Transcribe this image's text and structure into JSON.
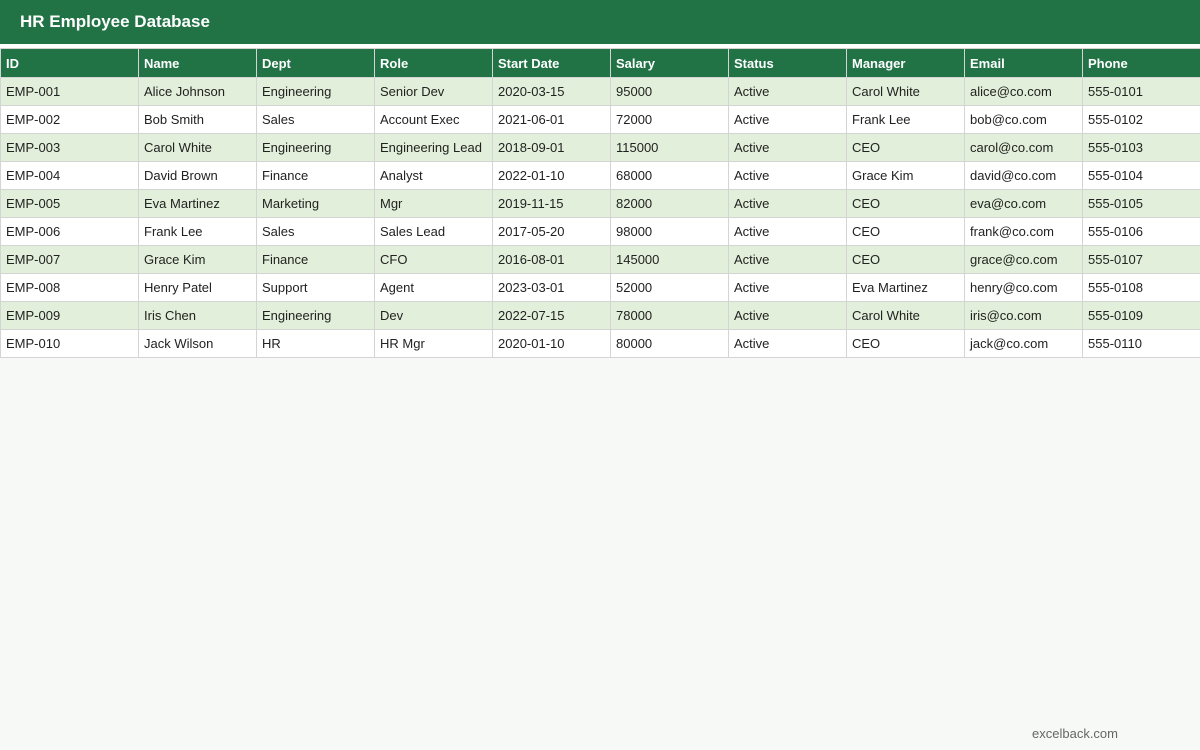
{
  "app": {
    "title": "HR Employee Database",
    "accent_color": "#217346",
    "band_color": "#e2efda"
  },
  "table": {
    "columns": [
      "ID",
      "Name",
      "Dept",
      "Role",
      "Start Date",
      "Salary",
      "Status",
      "Manager",
      "Email",
      "Phone"
    ],
    "rows": [
      [
        "EMP-001",
        "Alice Johnson",
        "Engineering",
        "Senior Dev",
        "2020-03-15",
        "95000",
        "Active",
        "Carol White",
        "alice@co.com",
        "555-0101"
      ],
      [
        "EMP-002",
        "Bob Smith",
        "Sales",
        "Account Exec",
        "2021-06-01",
        "72000",
        "Active",
        "Frank Lee",
        "bob@co.com",
        "555-0102"
      ],
      [
        "EMP-003",
        "Carol White",
        "Engineering",
        "Engineering Lead",
        "2018-09-01",
        "115000",
        "Active",
        "CEO",
        "carol@co.com",
        "555-0103"
      ],
      [
        "EMP-004",
        "David Brown",
        "Finance",
        "Analyst",
        "2022-01-10",
        "68000",
        "Active",
        "Grace Kim",
        "david@co.com",
        "555-0104"
      ],
      [
        "EMP-005",
        "Eva Martinez",
        "Marketing",
        "Mgr",
        "2019-11-15",
        "82000",
        "Active",
        "CEO",
        "eva@co.com",
        "555-0105"
      ],
      [
        "EMP-006",
        "Frank Lee",
        "Sales",
        "Sales Lead",
        "2017-05-20",
        "98000",
        "Active",
        "CEO",
        "frank@co.com",
        "555-0106"
      ],
      [
        "EMP-007",
        "Grace Kim",
        "Finance",
        "CFO",
        "2016-08-01",
        "145000",
        "Active",
        "CEO",
        "grace@co.com",
        "555-0107"
      ],
      [
        "EMP-008",
        "Henry Patel",
        "Support",
        "Agent",
        "2023-03-01",
        "52000",
        "Active",
        "Eva Martinez",
        "henry@co.com",
        "555-0108"
      ],
      [
        "EMP-009",
        "Iris Chen",
        "Engineering",
        "Dev",
        "2022-07-15",
        "78000",
        "Active",
        "Carol White",
        "iris@co.com",
        "555-0109"
      ],
      [
        "EMP-010",
        "Jack Wilson",
        "HR",
        "HR Mgr",
        "2020-01-10",
        "80000",
        "Active",
        "CEO",
        "jack@co.com",
        "555-0110"
      ]
    ]
  },
  "footer": {
    "text": "excelback.com"
  }
}
